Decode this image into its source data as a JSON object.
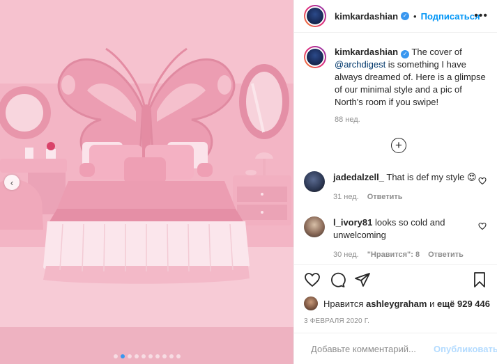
{
  "post": {
    "username": "kimkardashian",
    "follow_label": "Подписаться",
    "more_icon": "•••",
    "caption": {
      "username": "kimkardashian",
      "text_before": " The cover of ",
      "mention": "@archdigest",
      "text_after": " is something I have always dreamed of. Here is a glimpse of our minimal style and a pic of North's room if you swipe!",
      "time": "88 нед."
    },
    "comments": [
      {
        "username": "jadedalzell_",
        "text": "That is def my style 😍",
        "time": "31 нед.",
        "reply_label": "Ответить",
        "likes_label": ""
      },
      {
        "username": "l_ivory81",
        "text": "looks so cold and unwelcoming",
        "time": "30 нед.",
        "likes_label": "\"Нравится\": 8",
        "reply_label": "Ответить"
      }
    ],
    "likes": {
      "prefix": "Нравится",
      "user": "ashleygraham",
      "joiner": "и",
      "count_text": "ещё 929 446"
    },
    "date": "3 ФЕВРАЛЯ 2020 Г.",
    "add_comment": {
      "placeholder": "Добавьте комментарий...",
      "publish_label": "Опубликовать"
    },
    "carousel": {
      "total": 10,
      "active": 1
    },
    "colors": {
      "accent": "#0095f6",
      "text": "#262626",
      "muted": "#8e8e8e",
      "room_pink": "#f2b3c4"
    }
  }
}
